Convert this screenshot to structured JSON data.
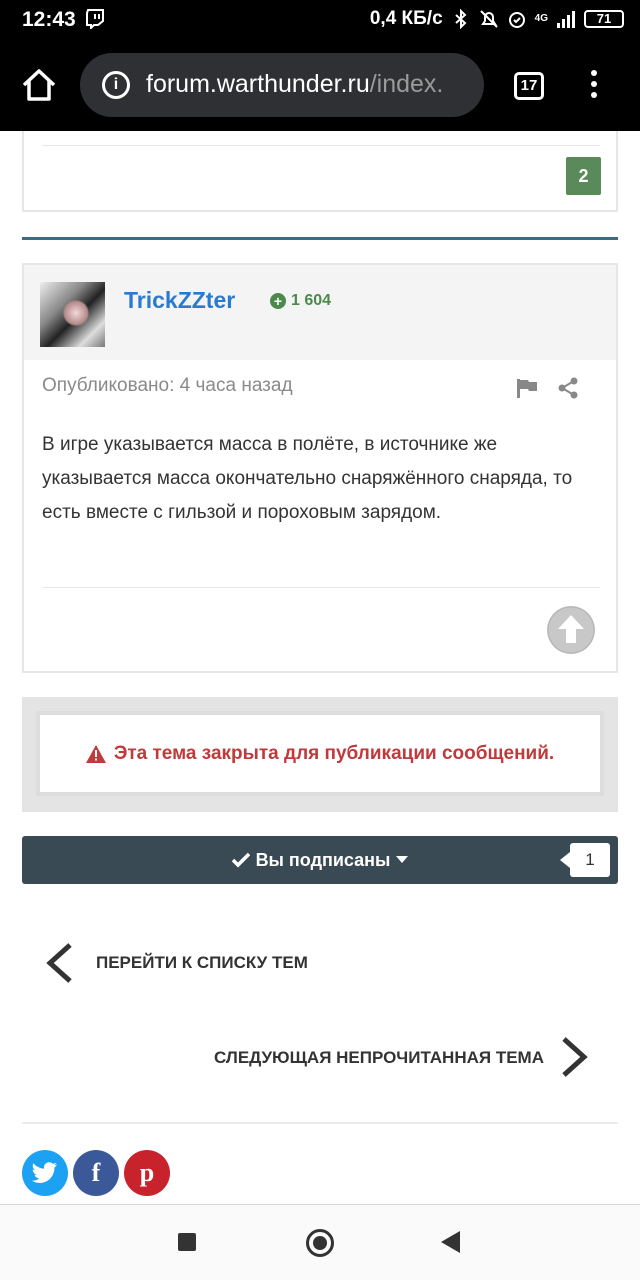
{
  "status_bar": {
    "time": "12:43",
    "network_speed": "0,4 КБ/с",
    "network_type": "4G",
    "battery": "71"
  },
  "browser": {
    "url_host": "forum.warthunder.ru",
    "url_path": "/index.",
    "tab_count": "17"
  },
  "previous_post": {
    "reaction_count": "2"
  },
  "post": {
    "author": "TrickZZter",
    "reputation": "1 604",
    "meta": "Опубликовано: 4 часа назад",
    "body": "В игре указывается масса в полёте, в источнике же указывается масса окончательно снаряжённого снаряда, то есть вместе с гильзой и пороховым зарядом."
  },
  "locked_notice": "Эта тема закрыта для публикации сообщений.",
  "follow": {
    "label": "Вы подписаны",
    "count": "1"
  },
  "navigation": {
    "back_label": "ПЕРЕЙТИ К СПИСКУ ТЕМ",
    "next_label": "СЛЕДУЮЩАЯ НЕПРОЧИТАННАЯ ТЕМА"
  },
  "share": {
    "twitter_glyph": "t",
    "facebook_glyph": "f",
    "pinterest_glyph": "p"
  },
  "colors": {
    "author_link": "#2a7bd0",
    "reputation": "#4b8a4b",
    "locked_text": "#c0393b",
    "follow_bar": "#3a4a54",
    "twitter": "#1da1f2",
    "facebook": "#3b5998",
    "pinterest": "#c8232c"
  }
}
